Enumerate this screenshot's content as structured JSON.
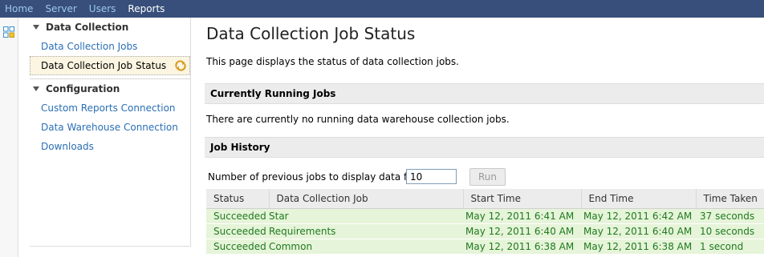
{
  "nav": {
    "items": [
      {
        "label": "Home",
        "active": false
      },
      {
        "label": "Server",
        "active": false
      },
      {
        "label": "Users",
        "active": false
      },
      {
        "label": "Reports",
        "active": true
      }
    ]
  },
  "sidebar": {
    "sections": [
      {
        "title": "Data Collection",
        "items": [
          {
            "label": "Data Collection Jobs"
          },
          {
            "label": "Data Collection Job Status",
            "selected": true
          }
        ]
      },
      {
        "title": "Configuration",
        "items": [
          {
            "label": "Custom Reports Connection"
          },
          {
            "label": "Data Warehouse Connection"
          },
          {
            "label": "Downloads"
          }
        ]
      }
    ]
  },
  "main": {
    "title": "Data Collection Job Status",
    "intro": "This page displays the status of data collection jobs.",
    "running": {
      "heading": "Currently Running Jobs",
      "message": "There are currently no running data warehouse collection jobs."
    },
    "history": {
      "heading": "Job History",
      "count_label": "Number of previous jobs to display data for",
      "count_value": "10",
      "run_label": "Run",
      "columns": [
        "Status",
        "Data Collection Job",
        "Start Time",
        "End Time",
        "Time Taken"
      ],
      "rows": [
        [
          "Succeeded",
          "Star",
          "May 12, 2011 6:41 AM",
          "May 12, 2011 6:42 AM",
          "37 seconds"
        ],
        [
          "Succeeded",
          "Requirements",
          "May 12, 2011 6:40 AM",
          "May 12, 2011 6:40 AM",
          "10 seconds"
        ],
        [
          "Succeeded",
          "Common",
          "May 12, 2011 6:38 AM",
          "May 12, 2011 6:38 AM",
          "1 second"
        ]
      ]
    }
  },
  "colors": {
    "topbar": "#374f7a",
    "link": "#2a6fb5",
    "success_text": "#1f7a1f",
    "success_bg": "#e6f4d9"
  }
}
